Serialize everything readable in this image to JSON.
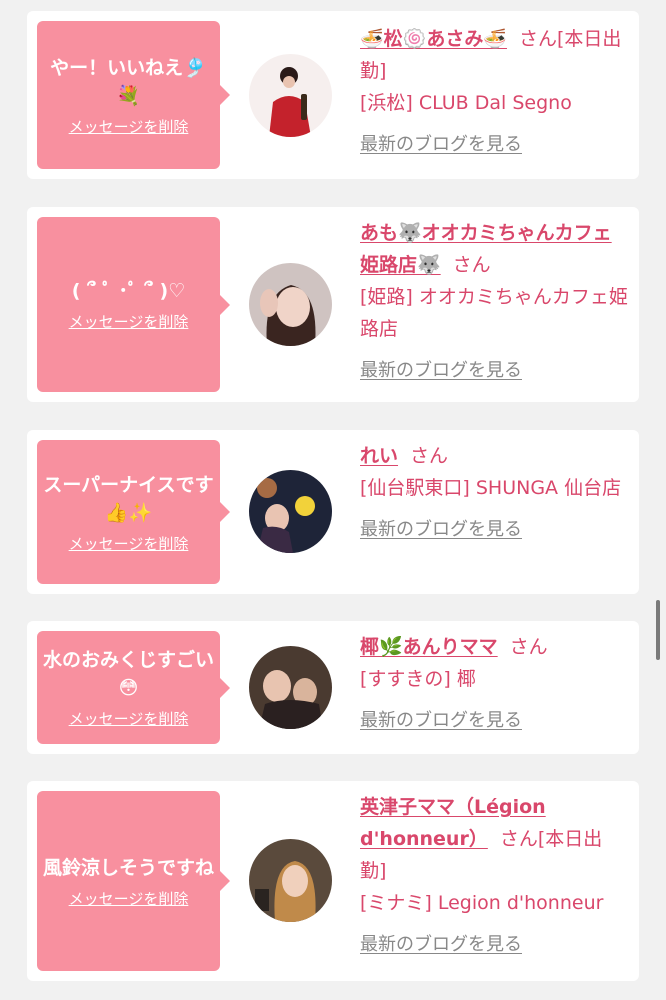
{
  "cards": [
    {
      "message": "やー！いいねえ🎐💐",
      "delete_label": "メッセージを削除",
      "name": "🍜松🍥あさみ🍜",
      "san": "さん",
      "status": "[本日出勤]",
      "shop": "[浜松] CLUB Dal Segno",
      "blog_label": "最新のブログを見る"
    },
    {
      "message": "( ՞ ﾟ ･ﾟ ՞ )♡",
      "delete_label": "メッセージを削除",
      "name": "あも🐺オオカミちゃんカフェ姫路店🐺",
      "san": "さん",
      "status": "",
      "shop": "[姫路] オオカミちゃんカフェ姫路店",
      "blog_label": "最新のブログを見る"
    },
    {
      "message": "スーパーナイスです👍✨",
      "delete_label": "メッセージを削除",
      "name": "れい",
      "san": "さん",
      "status": "",
      "shop": "[仙台駅東口] SHUNGA 仙台店",
      "blog_label": "最新のブログを見る"
    },
    {
      "message": "水のおみくじすごい😳",
      "delete_label": "メッセージを削除",
      "name": "椰🌿あんりママ",
      "san": "さん",
      "status": "",
      "shop": "[すすきの] 椰",
      "blog_label": "最新のブログを見る"
    },
    {
      "message": "風鈴涼しそうですね",
      "delete_label": "メッセージを削除",
      "name": "英津子ママ（Légion d'honneur）",
      "san": "さん",
      "status": "[本日出勤]",
      "shop": "[ミナミ] Legion d'honneur",
      "blog_label": "最新のブログを見る"
    }
  ]
}
